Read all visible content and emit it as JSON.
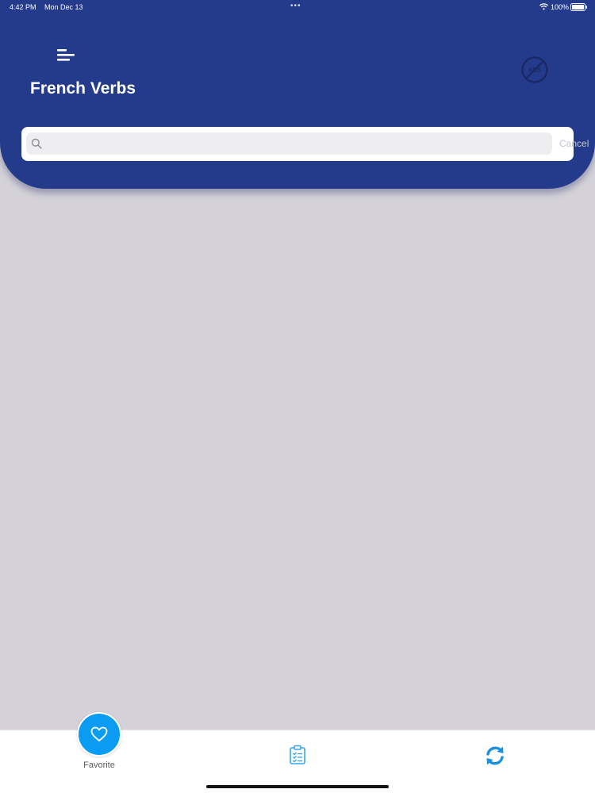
{
  "status_bar": {
    "time": "4:42 PM",
    "date": "Mon Dec 13",
    "dots": "•••",
    "battery": "100%"
  },
  "header": {
    "title": "French Verbs",
    "menu_icon": "menu-icon",
    "no_ads_icon": "no-ads-icon",
    "background_color": "#243b8c"
  },
  "search": {
    "value": "",
    "placeholder": "",
    "cancel_label": "Cancel"
  },
  "tab_bar": {
    "favorite_label": "Favorite",
    "accent_color": "#0a9cf2",
    "icons": [
      "heart-icon",
      "clipboard-checklist-icon",
      "refresh-icon"
    ]
  }
}
